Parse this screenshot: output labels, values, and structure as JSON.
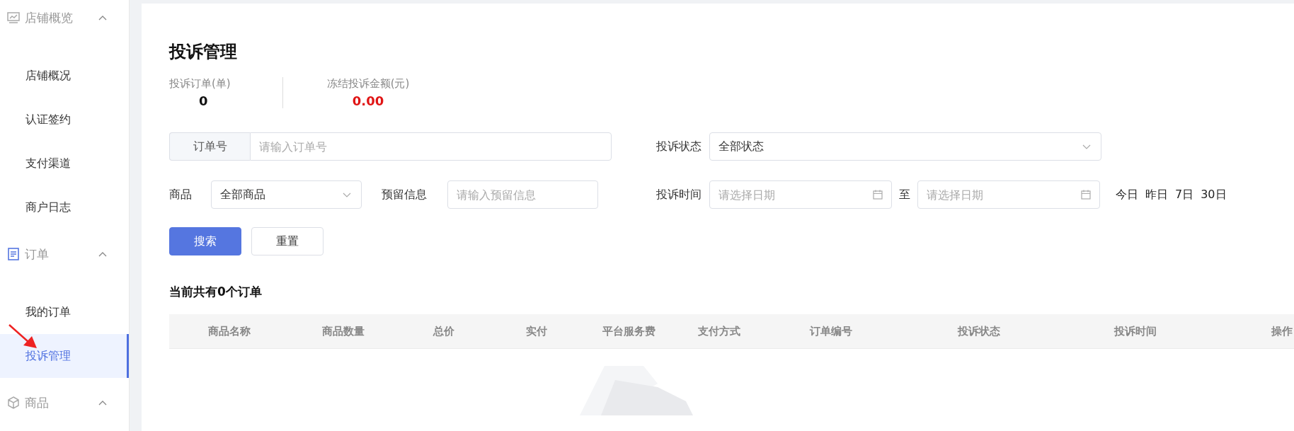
{
  "sidebar": {
    "groups": [
      {
        "label": "店铺概览",
        "expanded": true,
        "items": [
          {
            "label": "店铺概况",
            "selected": false
          },
          {
            "label": "认证签约",
            "selected": false
          },
          {
            "label": "支付渠道",
            "selected": false
          },
          {
            "label": "商户日志",
            "selected": false
          }
        ]
      },
      {
        "label": "订单",
        "expanded": true,
        "items": [
          {
            "label": "我的订单",
            "selected": false
          },
          {
            "label": "投诉管理",
            "selected": true
          }
        ]
      },
      {
        "label": "商品",
        "expanded": true
      }
    ]
  },
  "page": {
    "title": "投诉管理",
    "stats": [
      {
        "label": "投诉订单(单)",
        "value": "0",
        "kind": "plain"
      },
      {
        "label": "冻结投诉金额(元)",
        "value": "0.00",
        "kind": "alert"
      }
    ],
    "filters": {
      "order_no": {
        "addon": "订单号",
        "placeholder": "请输入订单号"
      },
      "status": {
        "label": "投诉状态",
        "value": "全部状态"
      },
      "product": {
        "label": "商品",
        "value": "全部商品"
      },
      "reserve": {
        "label": "预留信息",
        "placeholder": "请输入预留信息"
      },
      "time": {
        "label": "投诉时间",
        "start_placeholder": "请选择日期",
        "separator": "至",
        "end_placeholder": "请选择日期",
        "quick": [
          "今日",
          "昨日",
          "7日",
          "30日"
        ]
      }
    },
    "buttons": [
      {
        "label": "搜索",
        "kind": "primary"
      },
      {
        "label": "重置",
        "kind": "default"
      }
    ],
    "summary": "当前共有0个订单",
    "table": {
      "columns": [
        "商品名称",
        "商品数量",
        "总价",
        "实付",
        "平台服务费",
        "支付方式",
        "订单编号",
        "投诉状态",
        "投诉时间",
        "操作"
      ]
    }
  }
}
